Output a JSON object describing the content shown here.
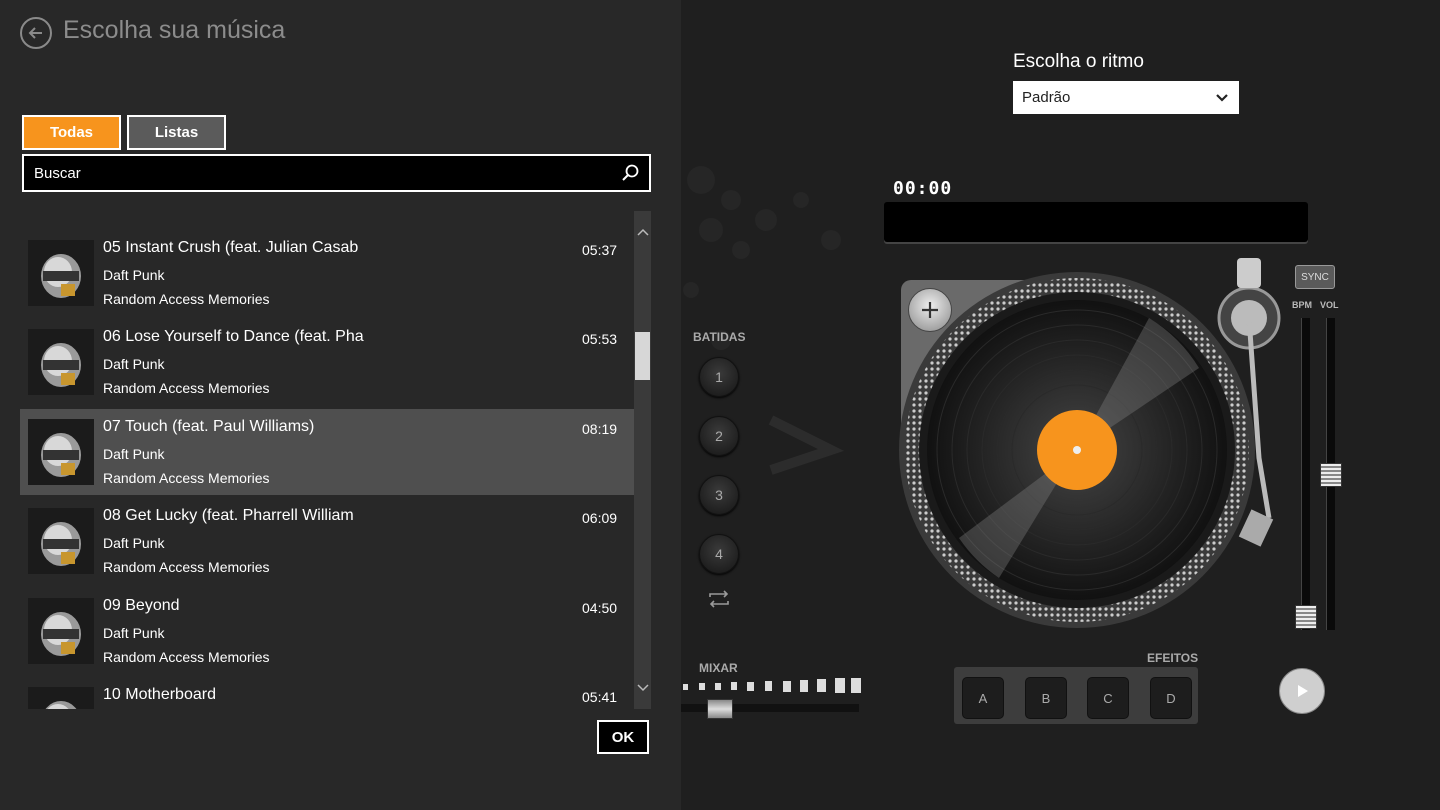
{
  "header": {
    "title": "Escolha sua música"
  },
  "tabs": {
    "all": "Todas",
    "lists": "Listas"
  },
  "search": {
    "placeholder": "Buscar"
  },
  "tracks": [
    {
      "title": "",
      "artist": "",
      "album": "Random Access Memories",
      "duration": ""
    },
    {
      "title": "05 Instant Crush (feat. Julian Casab",
      "artist": "Daft Punk",
      "album": "Random Access Memories",
      "duration": "05:37"
    },
    {
      "title": "06 Lose Yourself to Dance (feat. Pha",
      "artist": "Daft Punk",
      "album": "Random Access Memories",
      "duration": "05:53"
    },
    {
      "title": "07 Touch (feat. Paul Williams)",
      "artist": "Daft Punk",
      "album": "Random Access Memories",
      "duration": "08:19",
      "selected": true
    },
    {
      "title": "08 Get Lucky (feat. Pharrell William",
      "artist": "Daft Punk",
      "album": "Random Access Memories",
      "duration": "06:09"
    },
    {
      "title": "09 Beyond",
      "artist": "Daft Punk",
      "album": "Random Access Memories",
      "duration": "04:50"
    },
    {
      "title": "10 Motherboard",
      "artist": "",
      "album": "",
      "duration": "05:41"
    }
  ],
  "ok": "OK",
  "deck": {
    "rhythm_label": "Escolha o ritmo",
    "rhythm_value": "Padrão",
    "timer": "00:00",
    "batidas_label": "BATIDAS",
    "beats": [
      "1",
      "2",
      "3",
      "4"
    ],
    "mixar_label": "MIXAR",
    "efeitos_label": "EFEITOS",
    "effects": [
      "A",
      "B",
      "C",
      "D"
    ],
    "sync": "SYNC",
    "bpm": "BPM",
    "vol": "VOL",
    "accent_color": "#f7941d"
  }
}
